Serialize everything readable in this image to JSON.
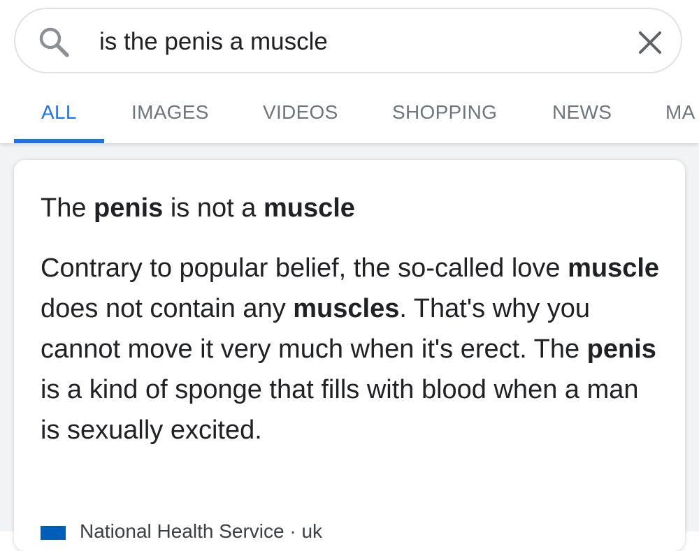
{
  "search": {
    "query": "is the penis a muscle",
    "search_icon": "search-icon",
    "clear_icon": "close-icon"
  },
  "tabs": [
    {
      "label": "ALL",
      "active": true
    },
    {
      "label": "IMAGES"
    },
    {
      "label": "VIDEOS"
    },
    {
      "label": "SHOPPING"
    },
    {
      "label": "NEWS"
    },
    {
      "label": "MA"
    }
  ],
  "featured_snippet": {
    "headline": {
      "t1": "The ",
      "b1": "penis",
      "t2": " is not a ",
      "b2": "muscle"
    },
    "body": {
      "t1": "Contrary to popular belief, the so-called love ",
      "b1": "muscle",
      "t2": " does not contain any ",
      "b2": "muscles",
      "t3": ". That's why you cannot move it very much when it's erect. The ",
      "b3": "penis",
      "t4": " is a kind of sponge that fills with blood when a man is sexually excited."
    },
    "source": "National Health Service · uk"
  },
  "colors": {
    "accent": "#1a73e8",
    "tab_text": "#70757a",
    "text": "#202124",
    "background": "#f1f3f4",
    "favicon": "#005eb8"
  }
}
